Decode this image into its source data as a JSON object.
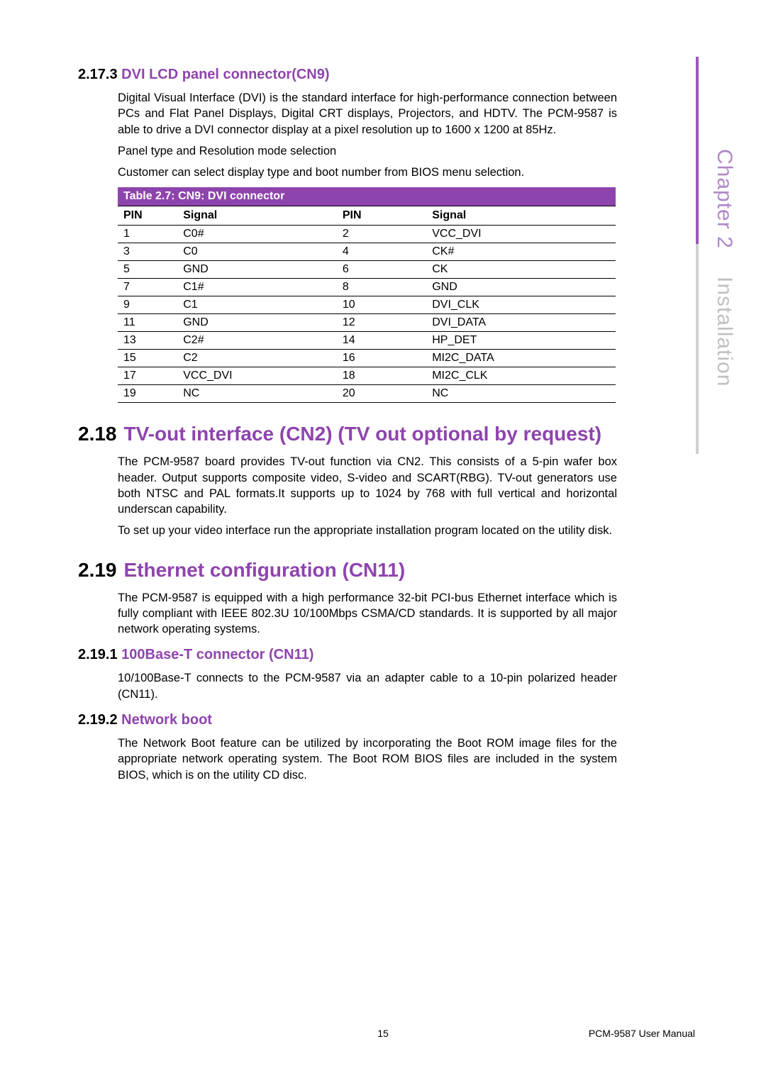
{
  "side": {
    "chapter": "Chapter 2",
    "name": "Installation"
  },
  "sections": {
    "s2173": {
      "num": "2.17.3",
      "title": "DVI LCD panel connector(CN9)",
      "p1": "Digital Visual Interface (DVI) is the standard interface for high-performance connection between PCs and Flat Panel Displays, Digital CRT displays, Projectors, and HDTV. The PCM-9587 is able to drive a DVI connector display at a pixel resolution up to 1600 x 1200 at 85Hz.",
      "p2": "Panel type and Resolution mode selection",
      "p3": "Customer can select display type and boot number from BIOS menu selection."
    },
    "table27": {
      "caption": "Table 2.7: CN9:  DVI connector",
      "headers": [
        "PIN",
        "Signal",
        "PIN",
        "Signal"
      ],
      "rows": [
        [
          "1",
          "C0#",
          "2",
          "VCC_DVI"
        ],
        [
          "3",
          "C0",
          "4",
          "CK#"
        ],
        [
          "5",
          "GND",
          "6",
          "CK"
        ],
        [
          "7",
          "C1#",
          "8",
          "GND"
        ],
        [
          "9",
          "C1",
          "10",
          "DVI_CLK"
        ],
        [
          "11",
          "GND",
          "12",
          "DVI_DATA"
        ],
        [
          "13",
          "C2#",
          "14",
          "HP_DET"
        ],
        [
          "15",
          "C2",
          "16",
          "MI2C_DATA"
        ],
        [
          "17",
          "VCC_DVI",
          "18",
          "MI2C_CLK"
        ],
        [
          "19",
          "NC",
          "20",
          "NC"
        ]
      ]
    },
    "s218": {
      "num": "2.18",
      "title": "TV-out interface  (CN2) (TV out optional by request)",
      "p1": "The PCM-9587 board provides TV-out function via CN2. This consists of a 5-pin wafer box header. Output supports composite video, S-video and SCART(RBG). TV-out generators use both NTSC and PAL formats.It supports up to 1024 by 768 with full vertical and horizontal underscan capability.",
      "p2": "To set up your video interface run the appropriate installation program located on the utility disk."
    },
    "s219": {
      "num": "2.19",
      "title": "Ethernet configuration (CN11)",
      "p1": "The PCM-9587 is equipped with a high performance 32-bit PCI-bus Ethernet interface which is fully compliant with IEEE 802.3U 10/100Mbps CSMA/CD standards. It is supported by all major network operating systems."
    },
    "s2191": {
      "num": "2.19.1",
      "title": "100Base-T connector (CN11)",
      "p1": "10/100Base-T connects to the PCM-9587 via an adapter cable to a 10-pin polarized header (CN11)."
    },
    "s2192": {
      "num": "2.19.2",
      "title": "Network boot",
      "p1": "The Network Boot feature can be utilized by incorporating the Boot ROM image files for the appropriate network operating system. The Boot ROM BIOS files are included in the system BIOS, which is on the utility CD disc."
    }
  },
  "footer": {
    "page": "15",
    "doc": "PCM-9587 User Manual"
  }
}
